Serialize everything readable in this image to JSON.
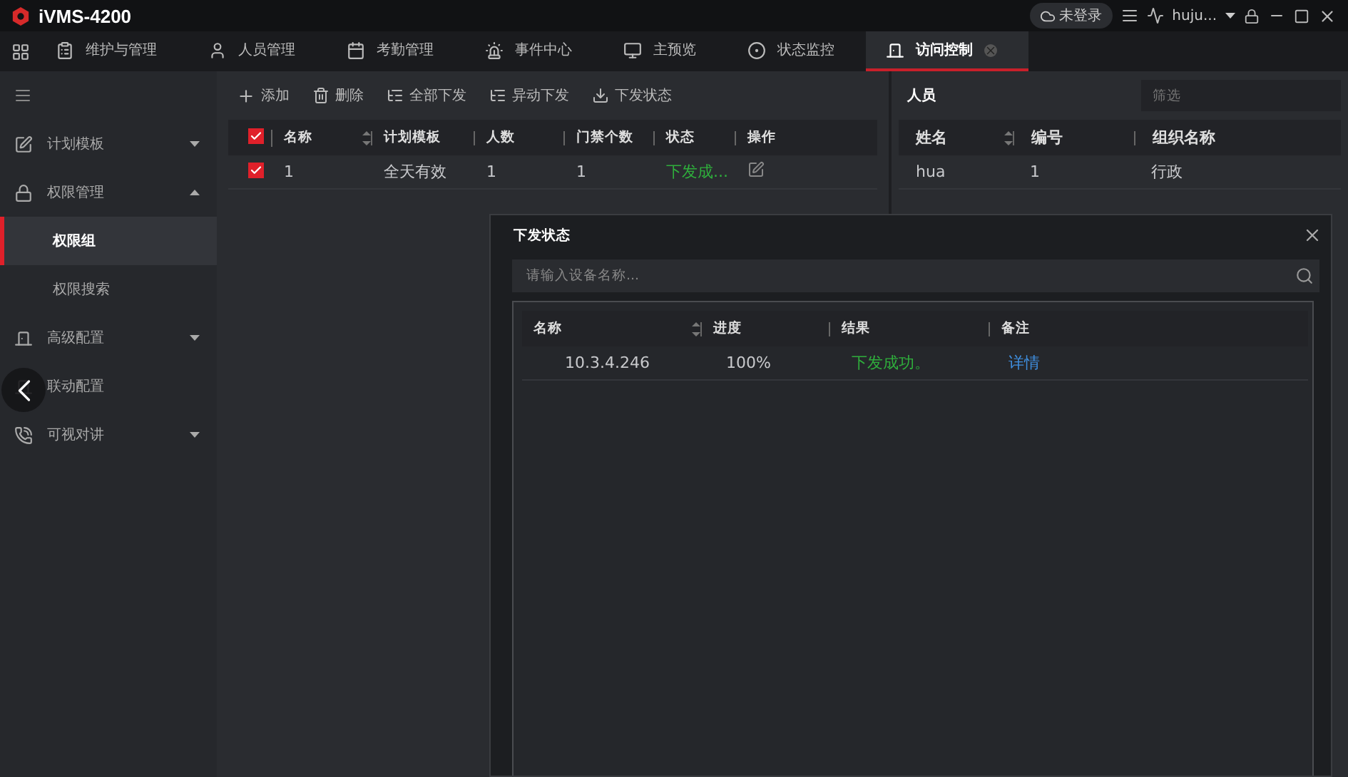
{
  "app": {
    "title": "iVMS-4200"
  },
  "title_bar": {
    "cloud_status": "未登录",
    "user": "huju..."
  },
  "nav_tabs": [
    {
      "label": "维护与管理",
      "selected": false
    },
    {
      "label": "人员管理",
      "selected": false
    },
    {
      "label": "考勤管理",
      "selected": false
    },
    {
      "label": "事件中心",
      "selected": false
    },
    {
      "label": "主预览",
      "selected": false
    },
    {
      "label": "状态监控",
      "selected": false
    },
    {
      "label": "访问控制",
      "selected": true
    }
  ],
  "sidebar": {
    "items": [
      {
        "kind": "group",
        "label": "计划模板",
        "expanded": false
      },
      {
        "kind": "group",
        "label": "权限管理",
        "expanded": true,
        "children": [
          {
            "label": "权限组",
            "selected": true
          },
          {
            "label": "权限搜索",
            "selected": false
          }
        ]
      },
      {
        "kind": "group",
        "label": "高级配置",
        "expanded": false
      },
      {
        "kind": "leaf",
        "label": "联动配置"
      },
      {
        "kind": "group",
        "label": "可视对讲",
        "expanded": false
      }
    ]
  },
  "toolbar": [
    {
      "label": "添加"
    },
    {
      "label": "删除"
    },
    {
      "label": "全部下发"
    },
    {
      "label": "异动下发"
    },
    {
      "label": "下发状态"
    }
  ],
  "group_table": {
    "all_checked": true,
    "columns": [
      {
        "label": "名称",
        "sortable": true
      },
      {
        "label": "计划模板",
        "sortable": false
      },
      {
        "label": "人数",
        "sortable": false
      },
      {
        "label": "门禁个数",
        "sortable": false
      },
      {
        "label": "状态",
        "sortable": false
      },
      {
        "label": "操作",
        "sortable": false
      }
    ],
    "rows": [
      {
        "checked": true,
        "name": "1",
        "template": "全天有效",
        "people": "1",
        "doors": "1",
        "status": "下发成..."
      }
    ]
  },
  "person_panel": {
    "title": "人员",
    "filter": {
      "placeholder": "筛选"
    },
    "columns": [
      {
        "label": "姓名",
        "sortable": true
      },
      {
        "label": "编号",
        "sortable": false
      },
      {
        "label": "组织名称",
        "sortable": false
      }
    ],
    "rows": [
      {
        "name": "hua",
        "number": "1",
        "org": "行政"
      }
    ]
  },
  "dialog": {
    "title": "下发状态",
    "search": {
      "placeholder": "请输入设备名称..."
    },
    "columns": [
      {
        "label": "名称",
        "sortable": true
      },
      {
        "label": "进度",
        "sortable": false
      },
      {
        "label": "结果",
        "sortable": false
      },
      {
        "label": "备注",
        "sortable": false
      }
    ],
    "rows": [
      {
        "device": "10.3.4.246",
        "progress": "100%",
        "result": "下发成功。",
        "note": "详情"
      }
    ]
  }
}
